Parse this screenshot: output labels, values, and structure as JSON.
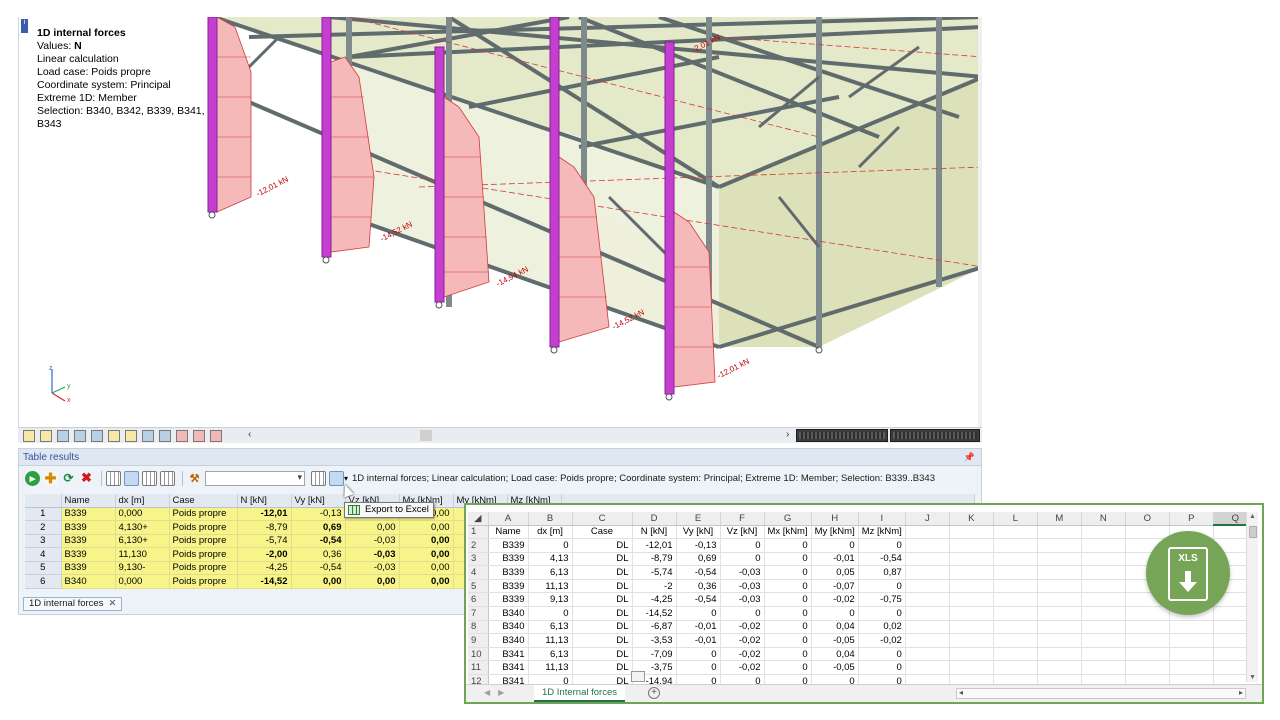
{
  "info": {
    "title": "1D internal forces",
    "values_label": "Values:",
    "values_value": "N",
    "line1": "Linear calculation",
    "line2": "Load case: Poids propre",
    "line3": "Coordinate system: Principal",
    "line4": "Extreme 1D: Member",
    "line5": "Selection: B340, B342, B339, B341,",
    "line6": "B343"
  },
  "force_labels": [
    "-12,01 kN",
    "-14,52 kN",
    "-14,94 kN",
    "-14,52 kN",
    "-12,01 kN",
    "-2,01 kN"
  ],
  "axis": {
    "z": "z",
    "y": "y",
    "x": "x"
  },
  "colors": {
    "column_magenta": "#c43fd0",
    "force_fill": "#f6b9b9",
    "force_line": "#d23a3a",
    "steel": "#7f8a8c",
    "slab": "#dbe2b7",
    "excel_green": "#217346",
    "badge_green": "#76a558",
    "table_yellow": "#f7f58a"
  },
  "table_results": {
    "panel_title": "Table results",
    "summary": "1D internal forces; Linear calculation; Load case: Poids propre; Coordinate system: Principal; Extreme 1D: Member; Selection: B339..B343",
    "tooltip": "Export to Excel",
    "tab_label": "1D internal forces",
    "columns": [
      "Name",
      "dx [m]",
      "Case",
      "N [kN]",
      "Vy [kN]",
      "Vz [kN]",
      "Mx [kNm]",
      "My [kNm]",
      "Mz [kNm]"
    ],
    "rows": [
      {
        "n": "1",
        "name": "B339",
        "dx": "0,000",
        "case": "Poids propre",
        "N": "-12,01",
        "Vy": "-0,13",
        "Vz": "0,00",
        "Mx": "0,00"
      },
      {
        "n": "2",
        "name": "B339",
        "dx": "4,130+",
        "case": "Poids propre",
        "N": "-8,79",
        "Vy": "0,69",
        "Vz": "0,00",
        "Mx": "0,00"
      },
      {
        "n": "3",
        "name": "B339",
        "dx": "6,130+",
        "case": "Poids propre",
        "N": "-5,74",
        "Vy": "-0,54",
        "Vz": "-0,03",
        "Mx": "0,00"
      },
      {
        "n": "4",
        "name": "B339",
        "dx": "11,130",
        "case": "Poids propre",
        "N": "-2,00",
        "Vy": "0,36",
        "Vz": "-0,03",
        "Mx": "0,00"
      },
      {
        "n": "5",
        "name": "B339",
        "dx": "9,130-",
        "case": "Poids propre",
        "N": "-4,25",
        "Vy": "-0,54",
        "Vz": "-0,03",
        "Mx": "0,00"
      },
      {
        "n": "6",
        "name": "B340",
        "dx": "0,000",
        "case": "Poids propre",
        "N": "-14,52",
        "Vy": "0,00",
        "Vz": "0,00",
        "Mx": "0,00"
      }
    ]
  },
  "excel": {
    "col_letters": [
      "A",
      "B",
      "C",
      "D",
      "E",
      "F",
      "G",
      "H",
      "I",
      "J",
      "K",
      "L",
      "M",
      "N",
      "O",
      "P",
      "Q"
    ],
    "sheet_name": "1D Internal forces",
    "add_sheet": "+",
    "badge_label": "XLS",
    "rows": [
      {
        "r": "1",
        "c": [
          "Name",
          "dx [m]",
          "Case",
          "N [kN]",
          "Vy [kN]",
          "Vz [kN]",
          "Mx [kNm]",
          "My [kNm]",
          "Mz [kNm]"
        ]
      },
      {
        "r": "2",
        "c": [
          "B339",
          "0",
          "DL",
          "-12,01",
          "-0,13",
          "0",
          "0",
          "0",
          "0"
        ]
      },
      {
        "r": "3",
        "c": [
          "B339",
          "4,13",
          "DL",
          "-8,79",
          "0,69",
          "0",
          "0",
          "-0,01",
          "-0,54"
        ]
      },
      {
        "r": "4",
        "c": [
          "B339",
          "6,13",
          "DL",
          "-5,74",
          "-0,54",
          "-0,03",
          "0",
          "0,05",
          "0,87"
        ]
      },
      {
        "r": "5",
        "c": [
          "B339",
          "11,13",
          "DL",
          "-2",
          "0,36",
          "-0,03",
          "0",
          "-0,07",
          "0"
        ]
      },
      {
        "r": "6",
        "c": [
          "B339",
          "9,13",
          "DL",
          "-4,25",
          "-0,54",
          "-0,03",
          "0",
          "-0,02",
          "-0,75"
        ]
      },
      {
        "r": "7",
        "c": [
          "B340",
          "0",
          "DL",
          "-14,52",
          "0",
          "0",
          "0",
          "0",
          "0"
        ]
      },
      {
        "r": "8",
        "c": [
          "B340",
          "6,13",
          "DL",
          "-6,87",
          "-0,01",
          "-0,02",
          "0",
          "0,04",
          "0,02"
        ]
      },
      {
        "r": "9",
        "c": [
          "B340",
          "11,13",
          "DL",
          "-3,53",
          "-0,01",
          "-0,02",
          "0",
          "-0,05",
          "-0,02"
        ]
      },
      {
        "r": "10",
        "c": [
          "B341",
          "6,13",
          "DL",
          "-7,09",
          "0",
          "-0,02",
          "0",
          "0,04",
          "0"
        ]
      },
      {
        "r": "11",
        "c": [
          "B341",
          "11,13",
          "DL",
          "-3,75",
          "0",
          "-0,02",
          "0",
          "-0,05",
          "0"
        ]
      },
      {
        "r": "12",
        "c": [
          "B341",
          "0",
          "DL",
          "-14,94",
          "0",
          "0",
          "0",
          "0",
          "0"
        ]
      }
    ]
  }
}
